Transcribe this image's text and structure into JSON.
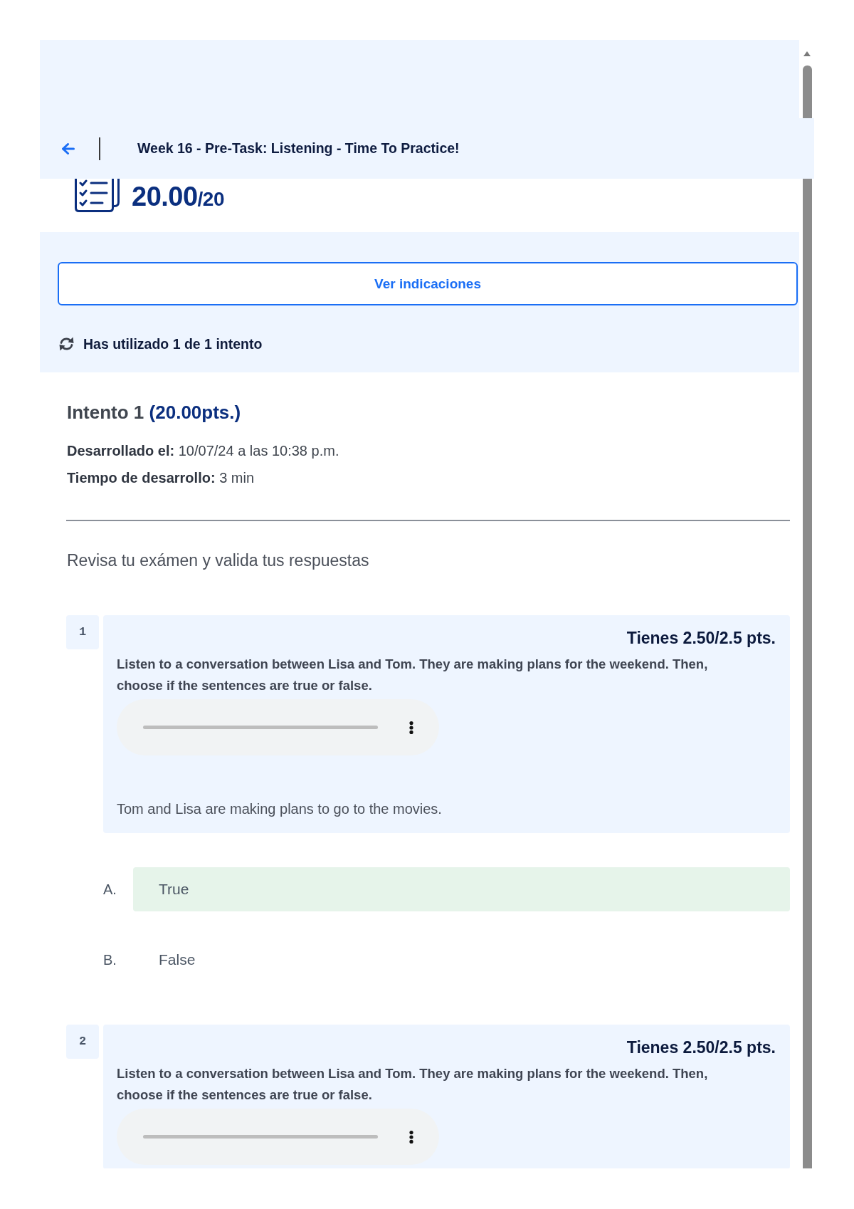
{
  "header": {
    "title": "Week 16 - Pre-Task: Listening - Time To Practice!"
  },
  "score": {
    "value": "20.00",
    "total": "/20"
  },
  "directions_button": {
    "label": "Ver indicaciones"
  },
  "attempts": {
    "text": "Has utilizado 1 de 1 intento"
  },
  "attempt": {
    "title": "Intento 1",
    "points": "(20.00pts.)",
    "details": [
      "**Desarrollado el:** 10/07/24 a las 10:38 p.m.",
      "**Tiempo de desarrollo:** 3 min"
    ]
  },
  "review_prompt": "Revisa tu exámen y valida tus respuestas",
  "questions": [
    {
      "number": "1",
      "score": "Tienes 2.50/2.5 pts.",
      "instructions": "Listen to a conversation between Lisa and Tom. They are making plans for the weekend. Then, choose if the sentences are true or false.",
      "audio_player": true,
      "statement": "Tom and Lisa are making plans to go to the movies.",
      "options": [
        {
          "letter": "A.",
          "text": "True",
          "selected": true
        },
        {
          "letter": "B.",
          "text": "False",
          "selected": false
        }
      ]
    },
    {
      "number": "2",
      "score": "Tienes 2.50/2.5 pts.",
      "instructions": "Listen to a conversation between Lisa and Tom. They are making plans for the weekend. Then, choose if the sentences are true or false.",
      "audio_player": true
    }
  ]
}
